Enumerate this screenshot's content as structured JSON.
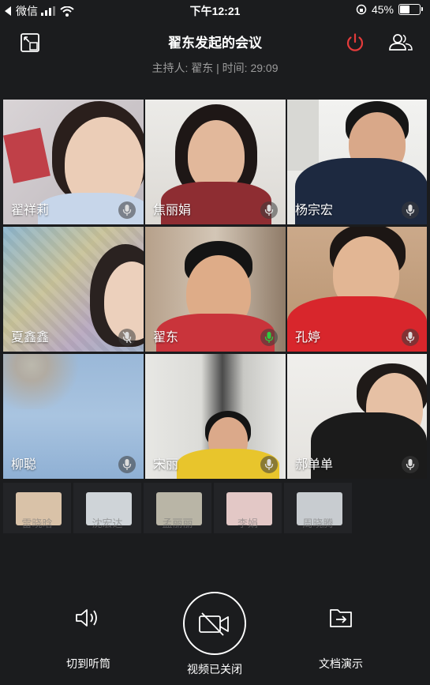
{
  "status_bar": {
    "back_app": "微信",
    "time": "下午12:21",
    "battery_text": "45%",
    "battery_level": 0.45
  },
  "header": {
    "title": "翟东发起的会议",
    "subtitle": "主持人: 翟东 | 时间: 29:09",
    "end_color": "#e43b3b"
  },
  "participants": [
    {
      "name": "翟祥莉",
      "mic": "muted"
    },
    {
      "name": "焦丽娟",
      "mic": "muted"
    },
    {
      "name": "杨宗宏",
      "mic": "muted"
    },
    {
      "name": "夏鑫鑫",
      "mic": "off"
    },
    {
      "name": "翟东",
      "mic": "active"
    },
    {
      "name": "孔婷",
      "mic": "muted"
    },
    {
      "name": "柳聪",
      "mic": "muted"
    },
    {
      "name": "宋丽",
      "mic": "muted"
    },
    {
      "name": "郝单单",
      "mic": "muted"
    }
  ],
  "thumbnails": [
    {
      "name": "雷晓晗"
    },
    {
      "name": "沈宏达"
    },
    {
      "name": "孟丽丽"
    },
    {
      "name": "李娟"
    },
    {
      "name": "周晓腾"
    }
  ],
  "controls": {
    "speaker_label": "切到听筒",
    "video_label": "视频已关闭",
    "doc_label": "文档演示"
  },
  "colors": {
    "active_mic": "#2ecc40",
    "background": "#1b1c1e"
  }
}
